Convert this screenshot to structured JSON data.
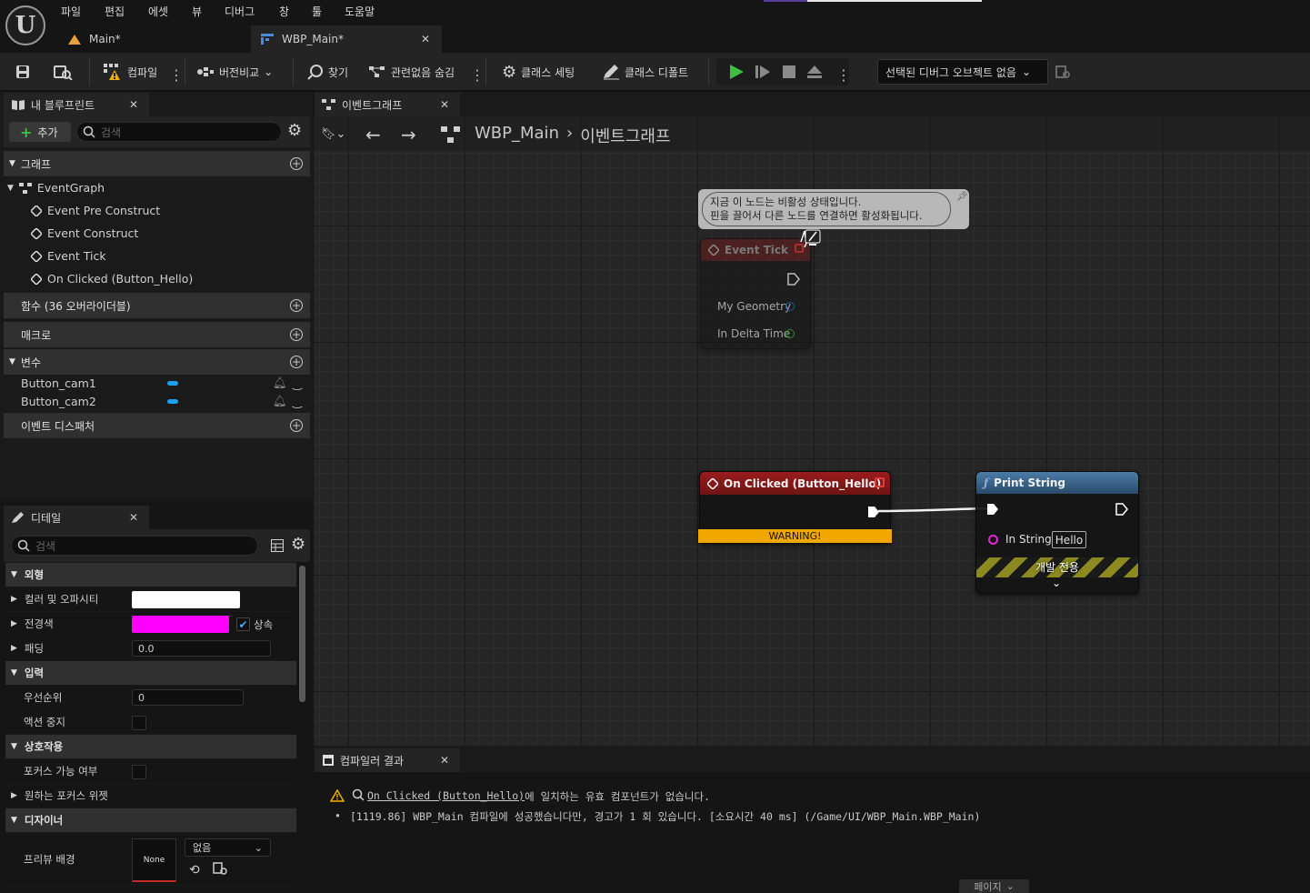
{
  "menu": [
    "파일",
    "편집",
    "에셋",
    "뷰",
    "디버그",
    "창",
    "툴",
    "도움말"
  ],
  "tabs": [
    {
      "label": "Main*",
      "icon": "level-icon"
    },
    {
      "label": "WBP_Main*",
      "icon": "widget-blueprint-icon"
    }
  ],
  "toolbar": {
    "compile": "컴파일",
    "diff": "버전비교",
    "find": "찾기",
    "hide_unrelated": "관련없음 숨김",
    "class_settings": "클래스 세팅",
    "class_defaults": "클래스 디폴트",
    "debug_object": "선택된 디버그 오브젝트 없음"
  },
  "my_blueprint": {
    "tab_label": "내 블루프린트",
    "add_label": "추가",
    "search_placeholder": "검색",
    "graphs_header": "그래프",
    "event_graph": "EventGraph",
    "events": [
      "Event Pre Construct",
      "Event Construct",
      "Event Tick",
      "On Clicked (Button_Hello)"
    ],
    "functions_header": "함수 (36 오버라이더블)",
    "macros_header": "매크로",
    "variables_header": "변수",
    "variables": [
      "Button_cam1",
      "Button_cam2"
    ],
    "dispatchers_header": "이벤트 디스패처"
  },
  "details": {
    "tab_label": "디테일",
    "search_placeholder": "검색",
    "appearance": "외형",
    "color_opacity": "컬러 및 오파시티",
    "foreground": "전경색",
    "inherit": "상속",
    "padding": "패딩",
    "padding_value": "0.0",
    "input": "입력",
    "priority": "우선순위",
    "priority_value": "0",
    "stop_action": "액션 중지",
    "interaction": "상호작용",
    "focusable": "포커스 가능 여부",
    "desired_focus": "원하는 포커스 위젯",
    "designer": "디자이너",
    "preview_bg": "프리뷰 배경",
    "preview_none": "None",
    "preview_dropdown": "없음",
    "color_white": "#ffffff",
    "color_magenta": "#ff00ff"
  },
  "graph": {
    "tab_label": "이벤트그래프",
    "breadcrumb_root": "WBP_Main",
    "breadcrumb_current": "이벤트그래프",
    "comment_line1": "지금 이 노드는 비활성 상태입니다.",
    "comment_line2": "핀을 끌어서 다른 노드를 연결하면 활성화됩니다.",
    "event_tick_title": "Event Tick",
    "pin_geometry": "My Geometry",
    "pin_delta": "In Delta Time",
    "onclicked_title": "On Clicked (Button_Hello)",
    "warning_label": "WARNING!",
    "print_title": "Print String",
    "pin_in_string": "In String",
    "in_string_value": "Hello",
    "dev_only": "개발 전용"
  },
  "compiler": {
    "tab_label": "컴파일러 결과",
    "warning_link": "On Clicked (Button_Hello)",
    "warning_rest": " 에 일치하는 유효 컴포넌트가 없습니다.",
    "log_line": "[1119.86] WBP_Main 컴파일에 성공했습니다만, 경고가 1 회 있습니다. [소요시간 40 ms] (/Game/UI/WBP_Main.WBP_Main)",
    "page_label": "페이지"
  }
}
